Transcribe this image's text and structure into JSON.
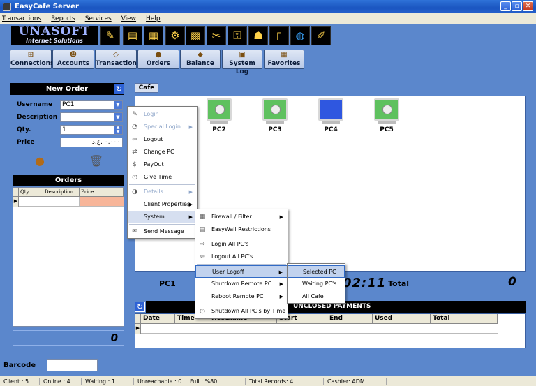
{
  "window": {
    "title": "EasyCafe Server"
  },
  "menubar": [
    "Transactions",
    "Reports",
    "Services",
    "View",
    "Help"
  ],
  "logo": {
    "text": "UNASOFT",
    "sub": "Internet Solutions"
  },
  "nav": [
    {
      "label": "Connections",
      "icon": "network-icon"
    },
    {
      "label": "Accounts",
      "icon": "users-icon"
    },
    {
      "label": "Transactions",
      "icon": "transactions-icon"
    },
    {
      "label": "Orders",
      "icon": "burger-icon"
    },
    {
      "label": "Balance",
      "icon": "balance-icon"
    },
    {
      "label": "System Log",
      "icon": "log-icon"
    },
    {
      "label": "Favorites",
      "icon": "favorites-icon"
    }
  ],
  "new_order": {
    "title": "New Order",
    "username_label": "Username",
    "username_value": "PC1",
    "description_label": "Description",
    "description_value": "",
    "qty_label": "Qty.",
    "qty_value": "1",
    "price_label": "Price",
    "price_value": "٠,٠٠٠ .ع.د"
  },
  "orders": {
    "title": "Orders",
    "columns": [
      "Qty.",
      "Description",
      "Price"
    ],
    "total": "0"
  },
  "cafe": {
    "tab": "Cafe",
    "pcs": [
      {
        "name": "PC2",
        "state": "green"
      },
      {
        "name": "PC3",
        "state": "green"
      },
      {
        "name": "PC4",
        "state": "blue"
      },
      {
        "name": "PC5",
        "state": "green"
      }
    ],
    "selected_pc": "PC1",
    "time": "02:11",
    "total_label": "Total",
    "total_value": "0"
  },
  "payments": {
    "title": "UNCLOSED PAYMENTS",
    "columns": [
      "Date",
      "Time",
      "Hostname",
      "Start",
      "End",
      "Used",
      "Total"
    ]
  },
  "barcode": {
    "label": "Barcode",
    "value": ""
  },
  "status": [
    "Client : 5",
    "Online : 4",
    "Waiting : 1",
    "Unreachable : 0",
    "Full : %80",
    "Total Records: 4",
    "Cashier: ADM"
  ],
  "context_menu": [
    {
      "label": "Login",
      "disabled": true
    },
    {
      "label": "Special Login",
      "disabled": true,
      "submenu": true
    },
    {
      "label": "Logout"
    },
    {
      "label": "Change PC"
    },
    {
      "label": "PayOut"
    },
    {
      "label": "Give Time"
    },
    {
      "label": "Details",
      "disabled": true,
      "submenu": true
    },
    {
      "label": "Client Properties",
      "submenu": true
    },
    {
      "label": "System",
      "submenu": true,
      "highlight": true
    },
    {
      "label": "Send Message"
    }
  ],
  "system_menu": [
    {
      "label": "Firewall / Filter",
      "submenu": true
    },
    {
      "label": "EasyWall Restrictions"
    },
    {
      "label": "Login All PC's"
    },
    {
      "label": "Logout All PC's"
    },
    {
      "label": "User Logoff",
      "submenu": true,
      "highlight": true
    },
    {
      "label": "Shutdown Remote PC",
      "submenu": true
    },
    {
      "label": "Reboot Remote PC",
      "submenu": true
    },
    {
      "label": "Shutdown All PC's by Time"
    }
  ],
  "logoff_menu": [
    {
      "label": "Selected PC",
      "highlight": true
    },
    {
      "label": "Waiting PC's"
    },
    {
      "label": "All Cafe"
    }
  ]
}
